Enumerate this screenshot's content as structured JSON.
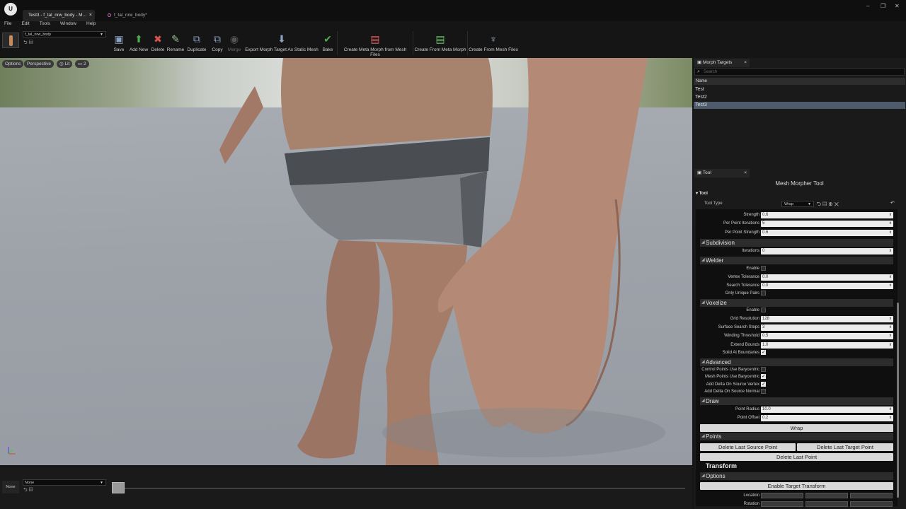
{
  "window": {
    "active_tab": "Test3 - f_tal_nrw_body - M...",
    "inactive_tab": "f_tal_nrw_body*",
    "close_glyph": "×",
    "controls": [
      "–",
      "❐",
      "✕"
    ]
  },
  "menu": [
    "File",
    "Edit",
    "Tools",
    "Window",
    "Help"
  ],
  "asset": {
    "name": "f_tal_nrw_body"
  },
  "toolbar": {
    "save": "Save",
    "add_new": "Add New",
    "delete": "Delete",
    "rename": "Rename",
    "duplicate": "Duplicate",
    "copy": "Copy",
    "merge": "Merge",
    "export": "Export Morph Target As Static Mesh",
    "bake": "Bake",
    "create_meta_from_mesh": "Create Meta Morph from Mesh Files",
    "create_from_meta": "Create From Meta Morph",
    "create_from_mesh": "Create From Mesh Files"
  },
  "viewport": {
    "options": "Options",
    "perspective": "Perspective",
    "lit": "Lit",
    "camera_count": "2"
  },
  "timeline": {
    "none_label": "None",
    "combo_value": "None"
  },
  "morph_panel": {
    "tab": "Morph Targets",
    "search_placeholder": "Search",
    "column": "Name",
    "items": [
      "Test",
      "Test2",
      "Test3"
    ],
    "selected_index": 2
  },
  "tool_panel": {
    "tab": "Tool",
    "title": "Mesh Morpher Tool",
    "section": "Tool",
    "tool_type_label": "Tool Type",
    "tool_type_value": "Wrap",
    "strength_label": "Strength",
    "strength": "0.6",
    "ppi_label": "Per Point Iterations",
    "ppi": "5",
    "pps_label": "Per Point Strength",
    "pps": "0.6",
    "subdivision": {
      "header": "Subdivision",
      "iterations_label": "Iterations",
      "iterations": "0"
    },
    "welder": {
      "header": "Welder",
      "enable_label": "Enable",
      "enable": false,
      "vertex_tol_label": "Vertex Tolerance",
      "vertex_tol": "0.0",
      "search_tol_label": "Search Tolerance",
      "search_tol": "0.0",
      "unique_label": "Only Unique Pairs",
      "unique": false
    },
    "voxelize": {
      "header": "Voxelize",
      "enable_label": "Enable",
      "enable": false,
      "grid_label": "Grid Resolution",
      "grid": "128",
      "surface_label": "Surface Search Steps",
      "surface": "3",
      "winding_label": "Winding Threshold",
      "winding": "0.5",
      "extend_label": "Extend Bounds",
      "extend": "1.0",
      "solid_label": "Solid At Boundaries",
      "solid": true
    },
    "advanced": {
      "header": "Advanced",
      "cp_label": "Control Points Use Barycentric",
      "cp": false,
      "mp_label": "Mesh Points Use Barycentric",
      "mp": true,
      "adsv_label": "Add Delta On Source Vertex",
      "adsv": true,
      "adsn_label": "Add Delta On Source Normal",
      "adsn": false
    },
    "draw": {
      "header": "Draw",
      "radius_label": "Point Radius",
      "radius": "10.0",
      "offset_label": "Point Offset",
      "offset": "0.2"
    },
    "wrap_button": "Wrap",
    "points": {
      "header": "Points",
      "del_source": "Delete Last Source Point",
      "del_target": "Delete Last Target Point",
      "del_last": "Delete Last Point"
    },
    "transform": {
      "header": "Transform",
      "options_header": "Options",
      "enable_button": "Enable Target Transform",
      "location_label": "Location",
      "rotation_label": "Rotation"
    }
  }
}
